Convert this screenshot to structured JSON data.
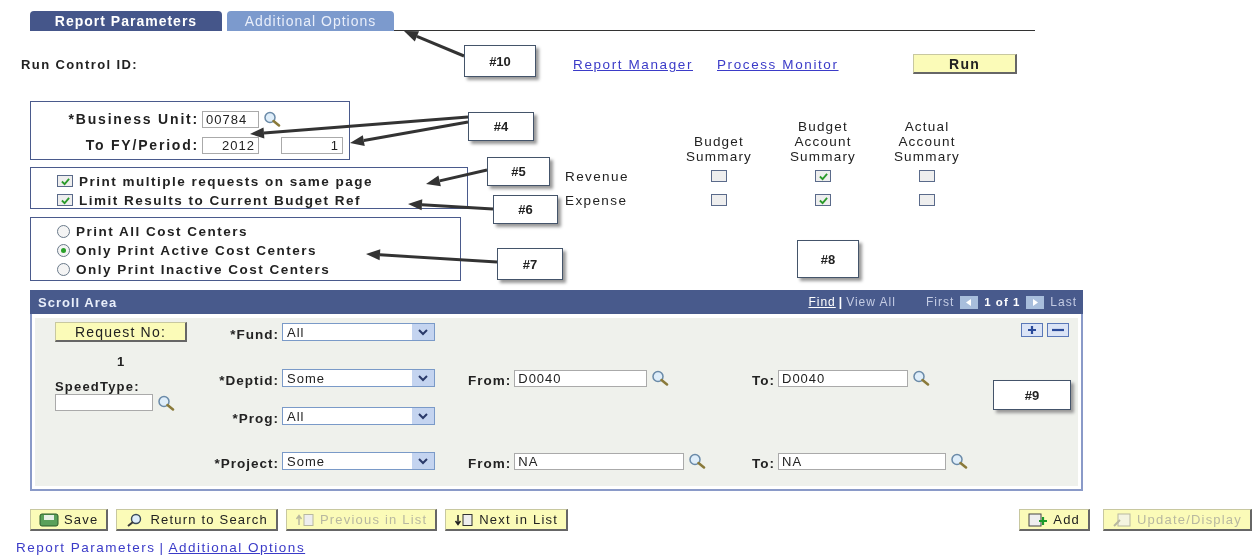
{
  "tabs": [
    {
      "label": "Report Parameters",
      "selected": true
    },
    {
      "label": "Additional Options",
      "selected": false
    }
  ],
  "run_control": {
    "label": "Run Control ID:"
  },
  "header_links": [
    "Report Manager",
    "Process Monitor"
  ],
  "run_button": "Run",
  "business_unit": {
    "label": "*Business Unit:",
    "value": "00784"
  },
  "fy_period": {
    "label": "To FY/Period:",
    "year": "2012",
    "period": "1"
  },
  "options": [
    {
      "label": "Print multiple requests on same page",
      "checked": true
    },
    {
      "label": "Limit Results to Current Budget Ref",
      "checked": true
    }
  ],
  "cost_centers": [
    {
      "label": "Print All Cost Centers",
      "selected": false
    },
    {
      "label": "Only Print Active Cost Centers",
      "selected": true
    },
    {
      "label": "Only Print Inactive Cost Centers",
      "selected": false
    }
  ],
  "summary_grid": {
    "columns": [
      "Budget Summary",
      "Budget Account Summary",
      "Actual Account Summary"
    ],
    "rows": [
      {
        "label": "Revenue",
        "checks": [
          false,
          true,
          false
        ]
      },
      {
        "label": "Expense",
        "checks": [
          false,
          true,
          false
        ]
      }
    ]
  },
  "scroll_area": {
    "title": "Scroll Area",
    "find": "Find",
    "separator": "|",
    "view_all": "View All",
    "first": "First",
    "count": "1 of 1",
    "last": "Last",
    "request_button": "Request No:",
    "request_number": "1",
    "speedtype_label": "SpeedType:",
    "fields": [
      {
        "kind": "select",
        "label": "*Fund:",
        "value": "All"
      },
      {
        "kind": "range",
        "label": "*Deptid:",
        "value": "Some",
        "from_label": "From:",
        "from": "D0040",
        "to_label": "To:",
        "to": "D0040"
      },
      {
        "kind": "select",
        "label": "*Prog:",
        "value": "All"
      },
      {
        "kind": "range",
        "label": "*Project:",
        "value": "Some",
        "from_label": "From:",
        "from": "NA",
        "to_label": "To:",
        "to": "NA"
      }
    ]
  },
  "toolbar": [
    {
      "label": "Save",
      "disabled": false
    },
    {
      "label": "Return to Search",
      "disabled": false
    },
    {
      "label": "Previous in List",
      "disabled": true
    },
    {
      "label": "Next in List",
      "disabled": false
    }
  ],
  "right_buttons": [
    {
      "label": "Add",
      "disabled": false
    },
    {
      "label": "Update/Display",
      "disabled": true
    }
  ],
  "footer_links": [
    {
      "label": "Report Parameters",
      "selected": true
    },
    {
      "label": "Additional Options",
      "selected": false
    }
  ],
  "footer_separator": "|",
  "callouts": [
    "#10",
    "#4",
    "#5",
    "#6",
    "#7",
    "#8",
    "#9"
  ]
}
